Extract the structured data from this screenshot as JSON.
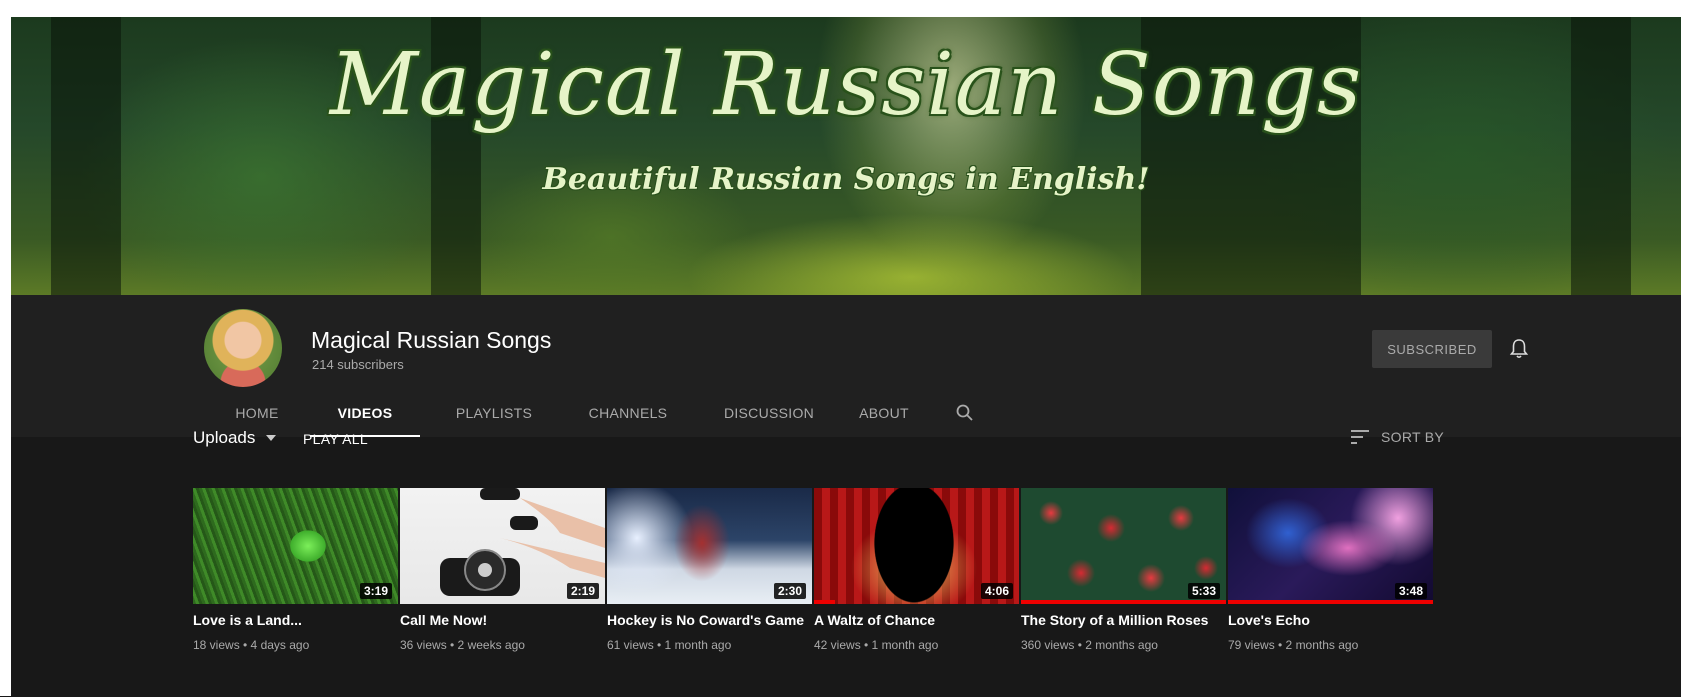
{
  "banner": {
    "title": "Magical Russian Songs",
    "subtitle": "Beautiful Russian Songs in English!"
  },
  "channel": {
    "name": "Magical Russian Songs",
    "subscribers": "214 subscribers",
    "subscribed_label": "SUBSCRIBED"
  },
  "tabs": [
    {
      "label": "HOME"
    },
    {
      "label": "VIDEOS"
    },
    {
      "label": "PLAYLISTS"
    },
    {
      "label": "CHANNELS"
    },
    {
      "label": "DISCUSSION"
    },
    {
      "label": "ABOUT"
    }
  ],
  "active_tab": "VIDEOS",
  "uploads": {
    "label": "Uploads",
    "play_all": "PLAY ALL",
    "sort_by": "SORT BY"
  },
  "videos": [
    {
      "title": "Love is a Land...",
      "meta": "18 views • 4 days ago",
      "duration": "3:19"
    },
    {
      "title": "Call Me Now!",
      "meta": "36 views • 2 weeks ago",
      "duration": "2:19"
    },
    {
      "title": "Hockey is No Coward's Game",
      "meta": "61 views • 1 month ago",
      "duration": "2:30"
    },
    {
      "title": "A Waltz of Chance",
      "meta": "42 views • 1 month ago",
      "duration": "4:06",
      "watched_fraction": 0.1
    },
    {
      "title": "The Story of a Million Roses",
      "meta": "360 views • 2 months ago",
      "duration": "5:33",
      "watched_fraction": 1.0
    },
    {
      "title": "Love's Echo",
      "meta": "79 views • 2 months ago",
      "duration": "3:48",
      "watched_fraction": 1.0
    }
  ],
  "colors": {
    "background": "#181818",
    "header": "#202020",
    "progress": "#ee0000",
    "muted_text": "#aaaaaa"
  },
  "icons": {
    "bell": "bell-icon",
    "search": "search-icon",
    "sort": "sort-icon",
    "caret": "caret-down-icon"
  }
}
